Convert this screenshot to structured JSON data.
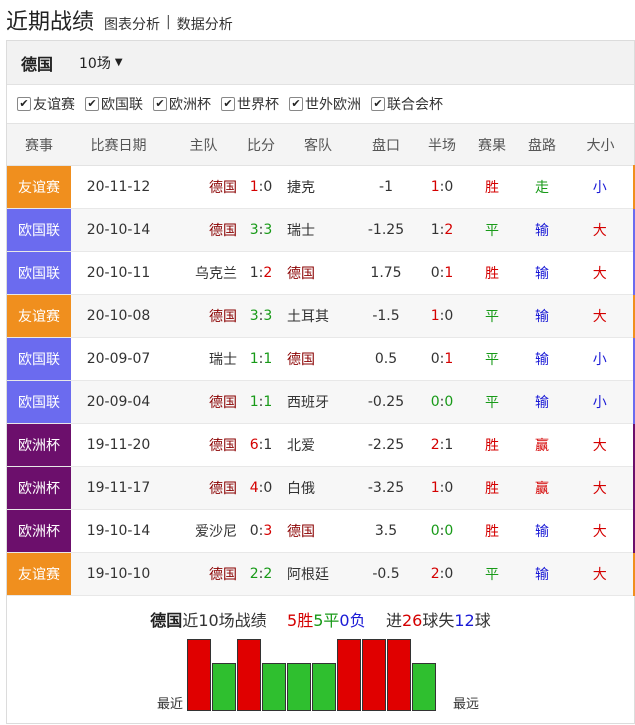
{
  "header": {
    "title": "近期战绩",
    "link_chart": "图表分析",
    "link_sep": "|",
    "link_data": "数据分析"
  },
  "teambar": {
    "team": "德国",
    "count": "10场"
  },
  "filters": [
    {
      "label": "友谊赛",
      "checked": true
    },
    {
      "label": "欧国联",
      "checked": true
    },
    {
      "label": "欧洲杯",
      "checked": true
    },
    {
      "label": "世界杯",
      "checked": true
    },
    {
      "label": "世外欧洲",
      "checked": true
    },
    {
      "label": "联合会杯",
      "checked": true
    }
  ],
  "columns": [
    "赛事",
    "比赛日期",
    "主队",
    "比分",
    "客队",
    "盘口",
    "半场",
    "赛果",
    "盘路",
    "大小"
  ],
  "event_colors": {
    "友谊赛": "#f08f1e",
    "欧国联": "#6b6bef",
    "欧洲杯": "#6c0f6c"
  },
  "rows": [
    {
      "event": "友谊赛",
      "date": "20-11-12",
      "home": "德国",
      "score_h": "1",
      "score_a": "0",
      "away": "捷克",
      "handicap": "-1",
      "half_h": "1",
      "half_a": "0",
      "result": "胜",
      "pan": "走",
      "ou": "小"
    },
    {
      "event": "欧国联",
      "date": "20-10-14",
      "home": "德国",
      "score_h": "3",
      "score_a": "3",
      "away": "瑞士",
      "handicap": "-1.25",
      "half_h": "1",
      "half_a": "2",
      "result": "平",
      "pan": "输",
      "ou": "大"
    },
    {
      "event": "欧国联",
      "date": "20-10-11",
      "home": "乌克兰",
      "score_h": "1",
      "score_a": "2",
      "away": "德国",
      "handicap": "1.75",
      "half_h": "0",
      "half_a": "1",
      "result": "胜",
      "pan": "输",
      "ou": "大"
    },
    {
      "event": "友谊赛",
      "date": "20-10-08",
      "home": "德国",
      "score_h": "3",
      "score_a": "3",
      "away": "土耳其",
      "handicap": "-1.5",
      "half_h": "1",
      "half_a": "0",
      "result": "平",
      "pan": "输",
      "ou": "大"
    },
    {
      "event": "欧国联",
      "date": "20-09-07",
      "home": "瑞士",
      "score_h": "1",
      "score_a": "1",
      "away": "德国",
      "handicap": "0.5",
      "half_h": "0",
      "half_a": "1",
      "result": "平",
      "pan": "输",
      "ou": "小"
    },
    {
      "event": "欧国联",
      "date": "20-09-04",
      "home": "德国",
      "score_h": "1",
      "score_a": "1",
      "away": "西班牙",
      "handicap": "-0.25",
      "half_h": "0",
      "half_a": "0",
      "result": "平",
      "pan": "输",
      "ou": "小"
    },
    {
      "event": "欧洲杯",
      "date": "19-11-20",
      "home": "德国",
      "score_h": "6",
      "score_a": "1",
      "away": "北爱",
      "handicap": "-2.25",
      "half_h": "2",
      "half_a": "1",
      "result": "胜",
      "pan": "赢",
      "ou": "大"
    },
    {
      "event": "欧洲杯",
      "date": "19-11-17",
      "home": "德国",
      "score_h": "4",
      "score_a": "0",
      "away": "白俄",
      "handicap": "-3.25",
      "half_h": "1",
      "half_a": "0",
      "result": "胜",
      "pan": "赢",
      "ou": "大"
    },
    {
      "event": "欧洲杯",
      "date": "19-10-14",
      "home": "爱沙尼",
      "score_h": "0",
      "score_a": "3",
      "away": "德国",
      "handicap": "3.5",
      "half_h": "0",
      "half_a": "0",
      "result": "胜",
      "pan": "输",
      "ou": "大"
    },
    {
      "event": "友谊赛",
      "date": "19-10-10",
      "home": "德国",
      "score_h": "2",
      "score_a": "2",
      "away": "阿根廷",
      "handicap": "-0.5",
      "half_h": "2",
      "half_a": "0",
      "result": "平",
      "pan": "输",
      "ou": "大"
    }
  ],
  "summary": {
    "team": "德国",
    "text1": "近10场战绩",
    "win": "5胜",
    "draw": "5平",
    "loss": "0负",
    "goals_prefix": "进",
    "goals_for": "26",
    "goals_mid": "球失",
    "goals_against": "12",
    "goals_suffix": "球",
    "recent_label": "最近",
    "far_label": "最远",
    "form": [
      "胜",
      "平",
      "胜",
      "平",
      "平",
      "平",
      "胜",
      "胜",
      "胜",
      "平"
    ]
  }
}
